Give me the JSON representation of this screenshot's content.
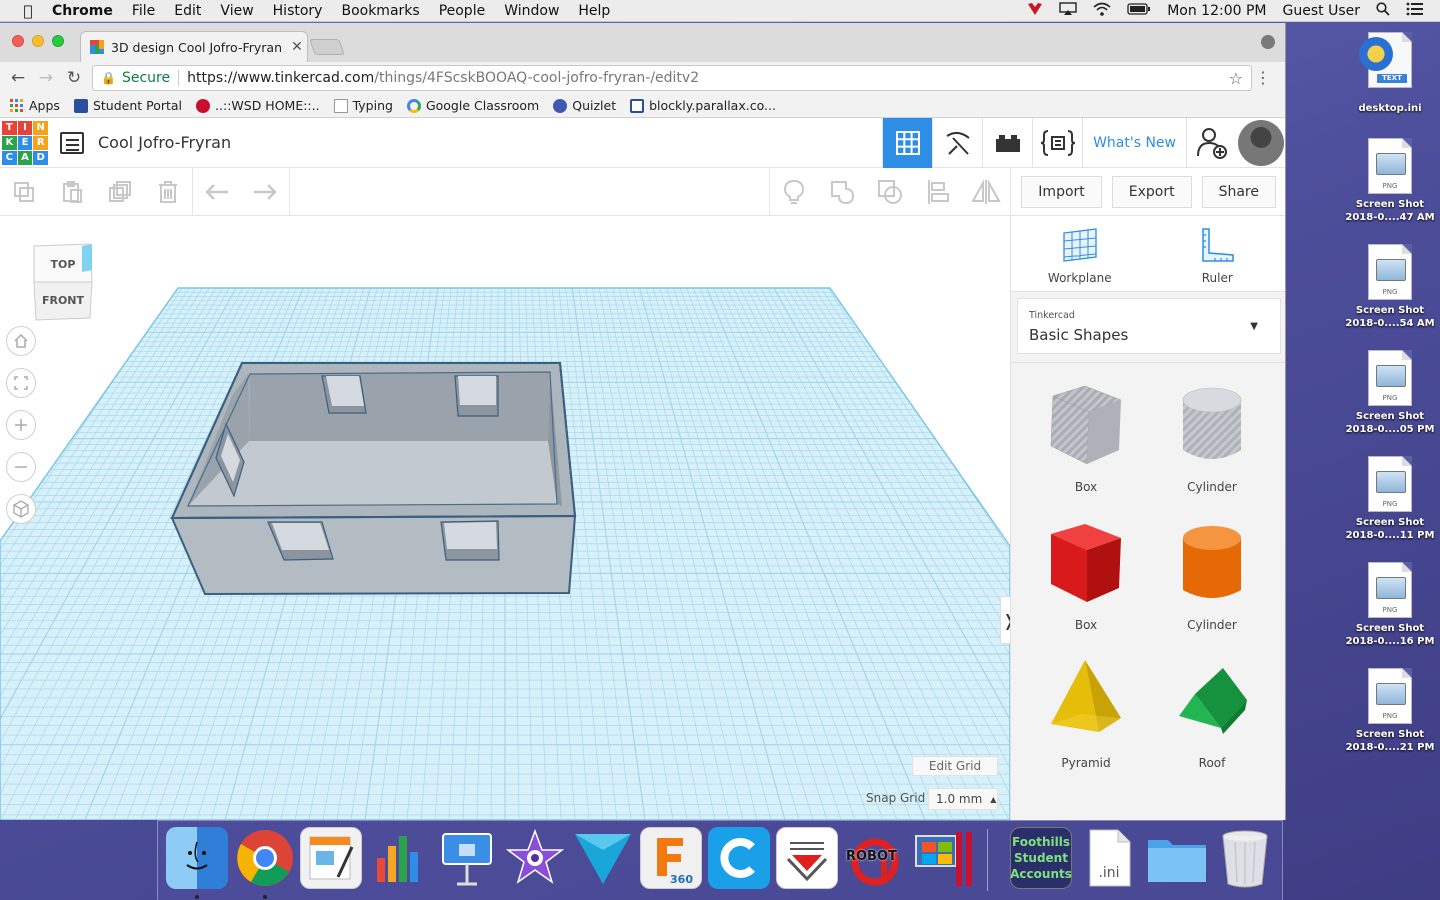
{
  "menubar": {
    "app": "Chrome",
    "items": [
      "File",
      "Edit",
      "View",
      "History",
      "Bookmarks",
      "People",
      "Window",
      "Help"
    ],
    "clock": "Mon 12:00 PM",
    "user": "Guest User"
  },
  "browser": {
    "tab_title": "3D design Cool Jofro-Fryran |",
    "secure_label": "Secure",
    "url_host": "https://www.tinkercad.com",
    "url_path": "/things/4FScskBOOAQ-cool-jofro-fryran-/editv2",
    "bookmarks": [
      "Apps",
      "Student Portal",
      "..::WSD HOME::..",
      "Typing",
      "Google Classroom",
      "Quizlet",
      "blockly.parallax.co..."
    ]
  },
  "tinkercad": {
    "logo_letters": [
      "T",
      "I",
      "N",
      "K",
      "E",
      "R",
      "C",
      "A",
      "D"
    ],
    "design_title": "Cool Jofro-Fryran",
    "whats_new": "What's New",
    "import": "Import",
    "export": "Export",
    "share": "Share",
    "viewcube_top": "TOP",
    "viewcube_front": "FRONT",
    "edit_grid": "Edit Grid",
    "snap_grid_label": "Snap Grid",
    "snap_grid_value": "1.0 mm",
    "workplane": "Workplane",
    "ruler": "Ruler",
    "library_small": "Tinkercad",
    "library_name": "Basic Shapes",
    "shapes": [
      "Box",
      "Cylinder",
      "Box",
      "Cylinder",
      "Pyramid",
      "Roof"
    ]
  },
  "desktop": {
    "files": [
      {
        "line1": "desktop.ini",
        "line2": ""
      },
      {
        "line1": "Screen Shot",
        "line2": "2018-0....47 AM"
      },
      {
        "line1": "Screen Shot",
        "line2": "2018-0....54 AM"
      },
      {
        "line1": "Screen Shot",
        "line2": "2018-0....05 PM"
      },
      {
        "line1": "Screen Shot",
        "line2": "2018-0....11 PM"
      },
      {
        "line1": "Screen Shot",
        "line2": "2018-0....16 PM"
      },
      {
        "line1": "Screen Shot",
        "line2": "2018-0....21 PM"
      }
    ],
    "text_badge": "TEXT",
    "png_tag": "PNG"
  },
  "dock": {
    "fusion_badge": "360",
    "robot_label": "ROBOT",
    "foothills": "Foothills Student Accounts",
    "ini_label": ".ini"
  },
  "colors": {
    "tinkercad_blue": "#2e8ee6",
    "grid_blue": "#bfe6f4",
    "box_red": "#e01f1f",
    "cylinder_orange": "#f07a10",
    "pyramid_yellow": "#f2c80f",
    "roof_green": "#1fa84a"
  }
}
